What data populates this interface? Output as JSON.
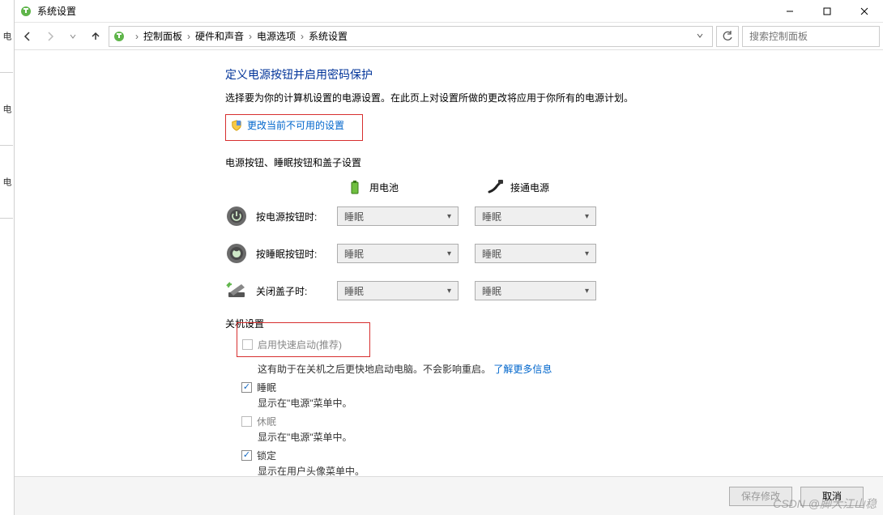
{
  "left_strip": {
    "items": [
      "电",
      "电",
      "电"
    ]
  },
  "titlebar": {
    "title": "系统设置"
  },
  "nav": {
    "breadcrumb": [
      "控制面板",
      "硬件和声音",
      "电源选项",
      "系统设置"
    ]
  },
  "search": {
    "placeholder": "搜索控制面板"
  },
  "main": {
    "heading": "定义电源按钮并启用密码保护",
    "desc": "选择要为你的计算机设置的电源设置。在此页上对设置所做的更改将应用于你所有的电源计划。",
    "change_link": "更改当前不可用的设置",
    "section_label": "电源按钮、睡眠按钮和盖子设置",
    "col_battery": "用电池",
    "col_plugged": "接通电源",
    "rows": [
      {
        "label": "按电源按钮时:",
        "battery": "睡眠",
        "plugged": "睡眠"
      },
      {
        "label": "按睡眠按钮时:",
        "battery": "睡眠",
        "plugged": "睡眠"
      },
      {
        "label": "关闭盖子时:",
        "battery": "睡眠",
        "plugged": "睡眠"
      }
    ],
    "shutdown": {
      "heading": "关机设置",
      "fast_startup": {
        "label": "启用快速启动(推荐)",
        "desc_pre": "这有助于在关机之后更快地启动电脑。不会影响重启。",
        "link": "了解更多信息"
      },
      "sleep": {
        "label": "睡眠",
        "desc": "显示在\"电源\"菜单中。"
      },
      "hibernate": {
        "label": "休眠",
        "desc": "显示在\"电源\"菜单中。"
      },
      "lock": {
        "label": "锁定",
        "desc": "显示在用户头像菜单中。"
      }
    }
  },
  "buttons": {
    "save": "保存修改",
    "cancel": "取消"
  },
  "watermark": "CSDN @脚大江山稳"
}
